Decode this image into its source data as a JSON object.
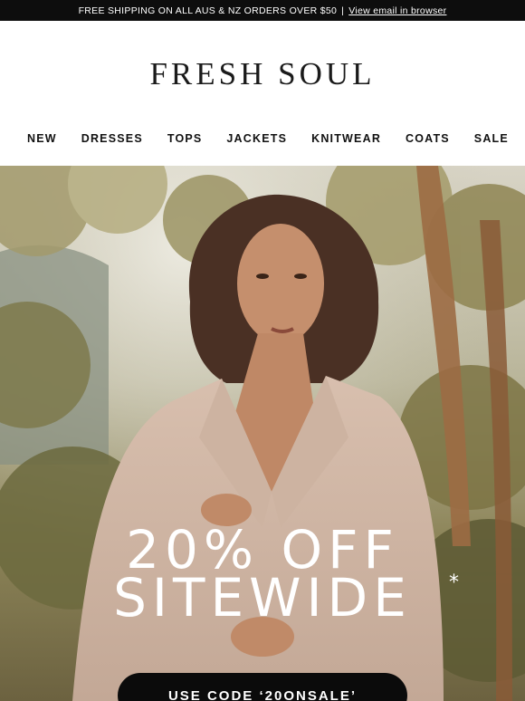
{
  "topbar": {
    "shipping_text": "FREE SHIPPING ON ALL AUS & NZ ORDERS OVER $50",
    "separator": "|",
    "view_link": "View email in browser"
  },
  "brand": {
    "logo_text": "FRESH SOUL"
  },
  "nav": {
    "items": [
      "NEW",
      "DRESSES",
      "TOPS",
      "JACKETS",
      "KNITWEAR",
      "COATS",
      "SALE"
    ]
  },
  "hero": {
    "headline_line1": "20% OFF",
    "headline_line2": "SITEWIDE",
    "asterisk": "*",
    "cta_label": "USE CODE ‘20ONSALE’"
  }
}
